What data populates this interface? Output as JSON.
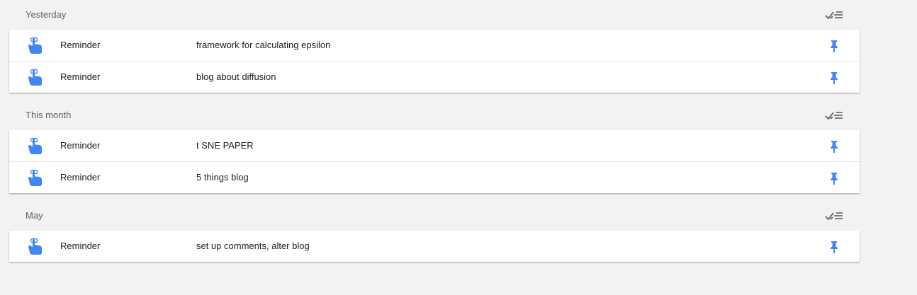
{
  "colors": {
    "background": "#f2f2f2",
    "accent": "#4285f4",
    "text": "#212121",
    "header_text": "#616161",
    "done_icon": "#5f5f5f"
  },
  "icons": {
    "reminder": "reminder-hand-icon",
    "pin": "pin-icon",
    "done_all": "done-all-icon"
  },
  "sections": [
    {
      "title": "Yesterday",
      "items": [
        {
          "type": "Reminder",
          "text": "framework for calculating epsilon"
        },
        {
          "type": "Reminder",
          "text": "blog about diffusion"
        }
      ]
    },
    {
      "title": "This month",
      "items": [
        {
          "type": "Reminder",
          "text": "t SNE PAPER"
        },
        {
          "type": "Reminder",
          "text": "5 things blog"
        }
      ]
    },
    {
      "title": "May",
      "items": [
        {
          "type": "Reminder",
          "text": "set up comments, alter blog"
        }
      ]
    }
  ]
}
